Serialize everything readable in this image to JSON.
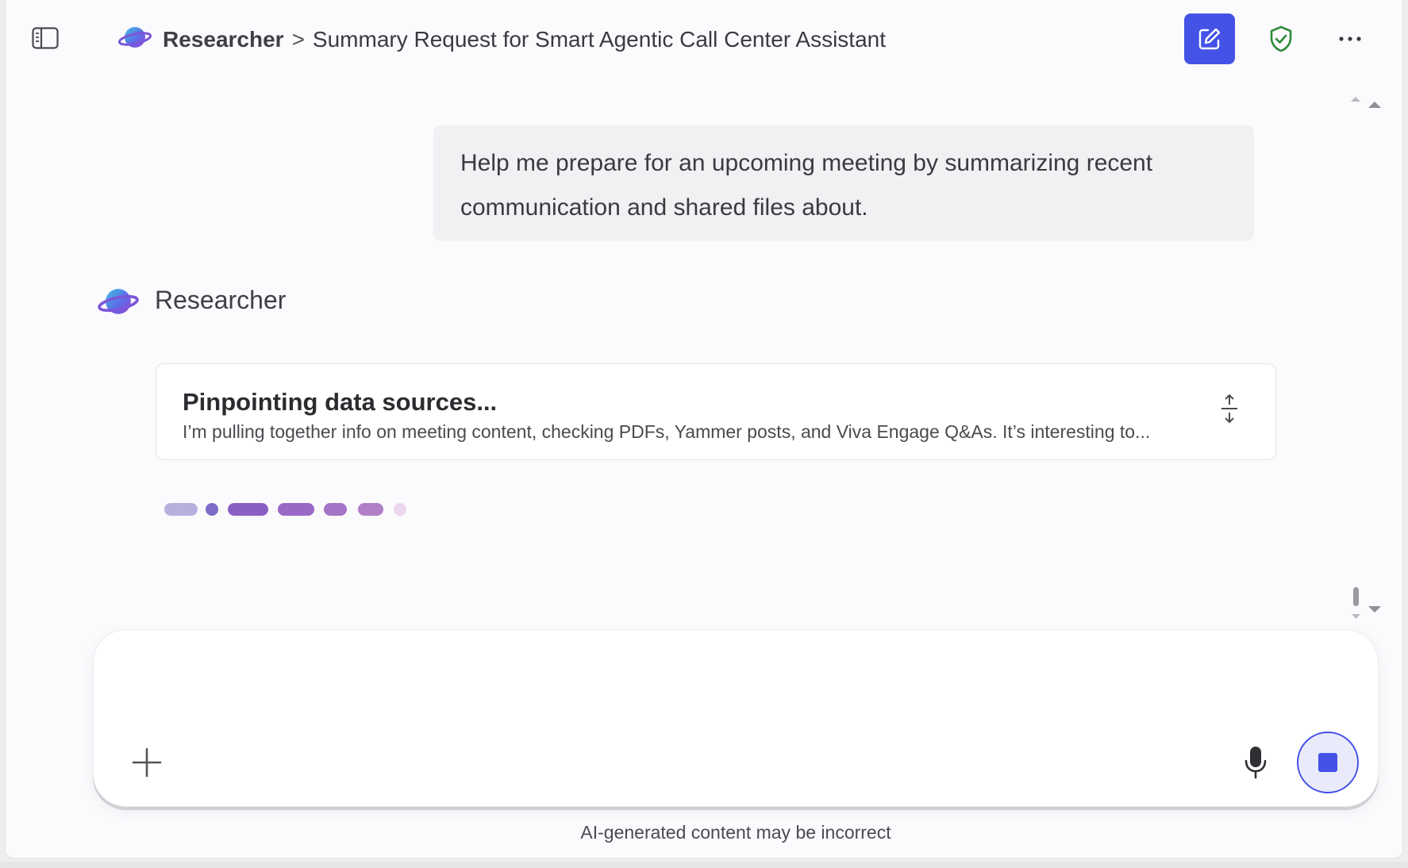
{
  "header": {
    "agent_name": "Researcher",
    "chevron": ">",
    "chat_title": "Summary Request for Smart Agentic Call Center Assistant",
    "icons": {
      "sidebar_toggle": "sidebar-panel-icon",
      "new_chat": "compose-icon",
      "shield": "shield-check-icon",
      "more": "more-dots-icon"
    }
  },
  "conversation": {
    "user_message": "Help me prepare for an upcoming meeting by summarizing recent communication and shared files about.",
    "assistant_name": "Researcher",
    "status_card": {
      "title": "Pinpointing data sources...",
      "description": "I’m pulling together info on meeting content, checking PDFs, Yammer posts, and Viva Engage Q&As. It’s interesting to..."
    }
  },
  "composer": {
    "placeholder": "",
    "value": ""
  },
  "footer": {
    "disclaimer": "AI-generated content may be incorrect"
  },
  "colors": {
    "accent": "#4552e6",
    "shield_green": "#2e8b3a",
    "background": "#fbfafd"
  }
}
